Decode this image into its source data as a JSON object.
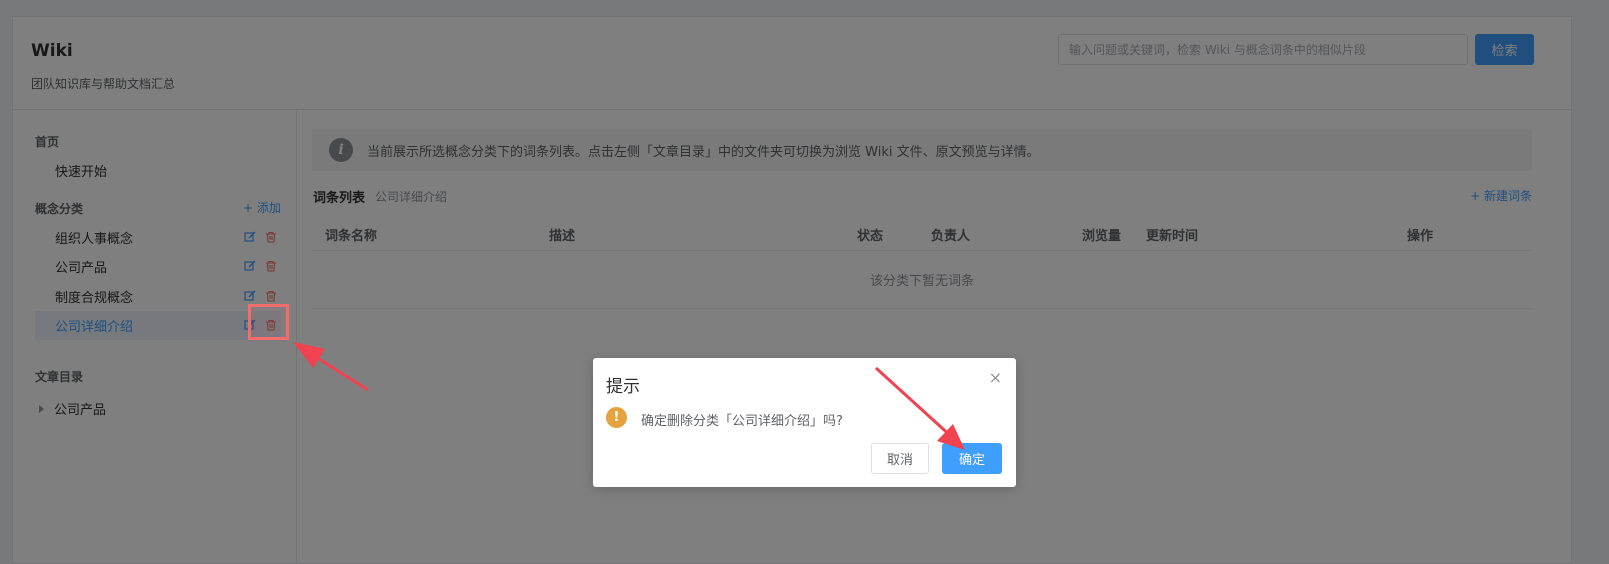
{
  "header": {
    "title": "Wiki",
    "subtitle": "团队知识库与帮助文档汇总",
    "search_placeholder": "输入问题或关键词，检索 Wiki 与概念词条中的相似片段",
    "search_button": "检索"
  },
  "sidebar": {
    "home_section": "首页",
    "home_item": "快速开始",
    "concept_section": "概念分类",
    "add_label": "+ 添加",
    "categories": [
      {
        "label": "组织人事概念"
      },
      {
        "label": "公司产品"
      },
      {
        "label": "制度合规概念"
      },
      {
        "label": "公司详细介绍"
      }
    ],
    "active_index": 3,
    "article_section": "文章目录",
    "article_tree": [
      {
        "label": "公司产品"
      }
    ]
  },
  "main": {
    "notice": "当前展示所选概念分类下的词条列表。点击左侧「文章目录」中的文件夹可切换为浏览 Wiki 文件、原文预览与详情。",
    "list_title": "词条列表",
    "list_subtitle": "公司详细介绍",
    "new_entry": "+ 新建词条",
    "columns": [
      "词条名称",
      "描述",
      "状态",
      "负责人",
      "浏览量",
      "更新时间",
      "操作"
    ],
    "empty_text": "该分类下暂无词条"
  },
  "dialog": {
    "title": "提示",
    "close": "×",
    "message": "确定删除分类「公司详细介绍」吗?",
    "cancel": "取消",
    "confirm": "确定"
  },
  "colors": {
    "primary": "#409eff",
    "danger": "#f56c6c",
    "warning": "#e6a23c",
    "annotation": "#f0434f"
  },
  "icons": [
    "info-icon",
    "edit-icon",
    "delete-icon",
    "warning-icon",
    "close-icon",
    "caret-right-icon"
  ]
}
